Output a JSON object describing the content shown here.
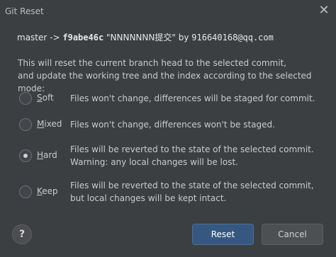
{
  "window": {
    "title": "Git Reset",
    "close_glyph": "✕"
  },
  "header": {
    "branch": "master",
    "arrow": "->",
    "hash": "f9abe46c",
    "message": "\"NNNNNNN提交\"",
    "by": "by",
    "email": "916640168@qq.com"
  },
  "description": {
    "line1": "This will reset the current branch head to the selected commit,",
    "line2": "and update the working tree and the index according to the selected mode:"
  },
  "modes": [
    {
      "label_first": "S",
      "label_rest": "oft",
      "line1": "Files won't change, differences will be staged for commit.",
      "line2": "",
      "selected": false
    },
    {
      "label_first": "M",
      "label_rest": "ixed",
      "line1": "Files won't change, differences won't be staged.",
      "line2": "",
      "selected": false
    },
    {
      "label_first": "H",
      "label_rest": "ard",
      "line1": "Files will be reverted to the state of the selected commit.",
      "line2": "Warning: any local changes will be lost.",
      "selected": true
    },
    {
      "label_first": "K",
      "label_rest": "eep",
      "line1": "Files will be reverted to the state of the selected commit,",
      "line2": "but local changes will be kept intact.",
      "selected": false
    }
  ],
  "buttons": {
    "help": "?",
    "reset": "Reset",
    "cancel": "Cancel"
  },
  "colors": {
    "primary_button": "#365880",
    "background": "#3c3f41"
  }
}
